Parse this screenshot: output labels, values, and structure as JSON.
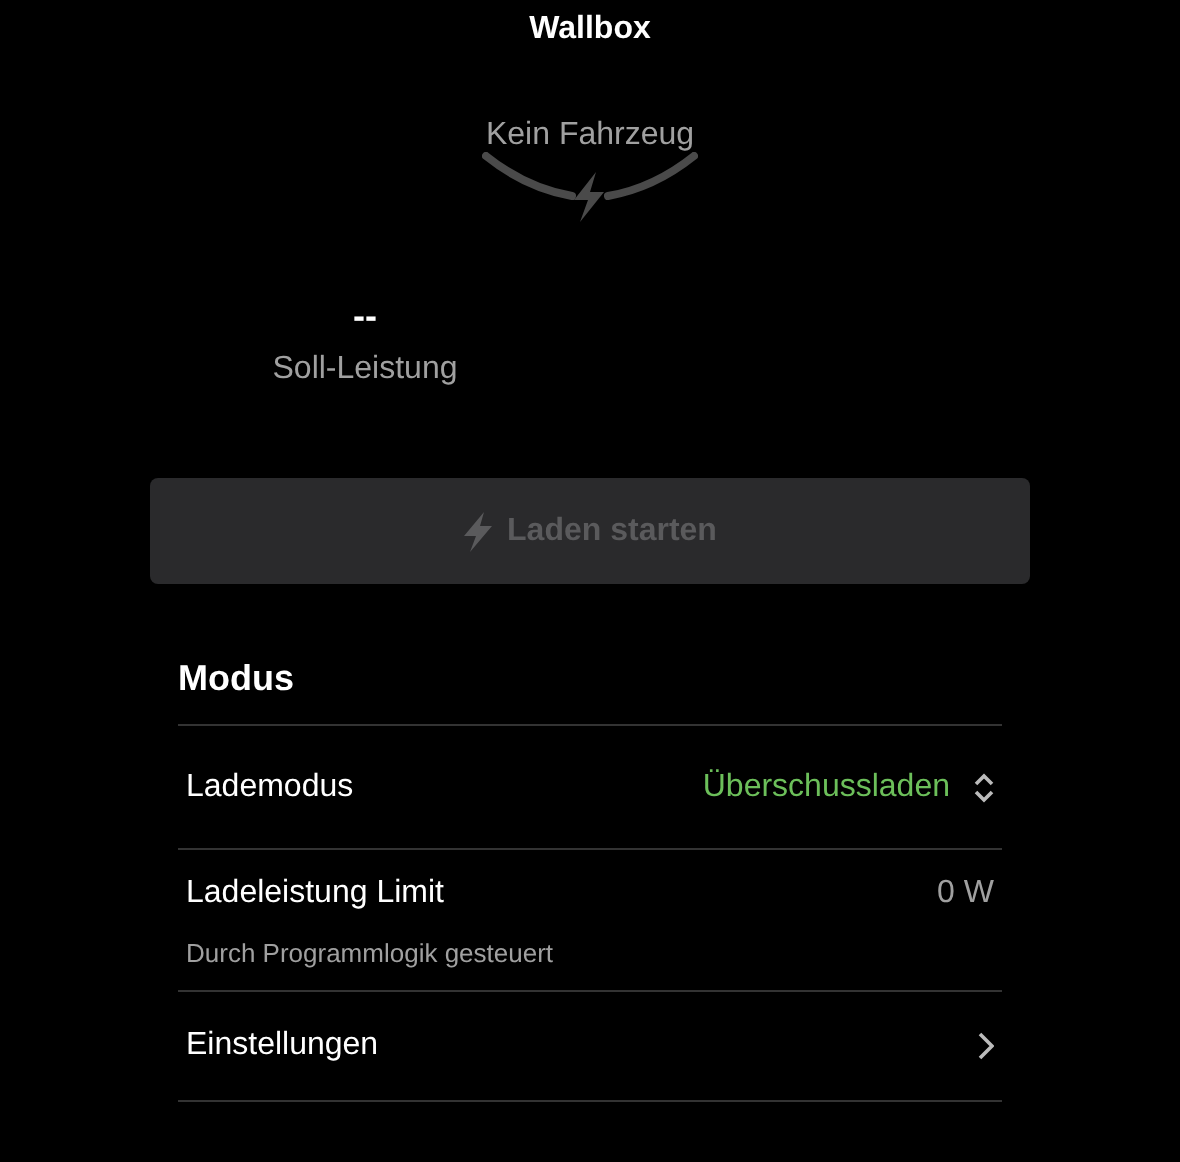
{
  "title": "Wallbox",
  "vehicle_status": "Kein Fahrzeug",
  "setpoint": {
    "value": "--",
    "label": "Soll-Leistung"
  },
  "start_button": {
    "label": "Laden starten",
    "disabled": true
  },
  "section": {
    "title": "Modus",
    "rows": [
      {
        "kind": "select",
        "label": "Lademodus",
        "value": "Überschussladen"
      },
      {
        "kind": "value",
        "label": "Ladeleistung Limit",
        "value": "0 W",
        "note": "Durch Programmlogik gesteuert"
      },
      {
        "kind": "link",
        "label": "Einstellungen"
      }
    ]
  }
}
